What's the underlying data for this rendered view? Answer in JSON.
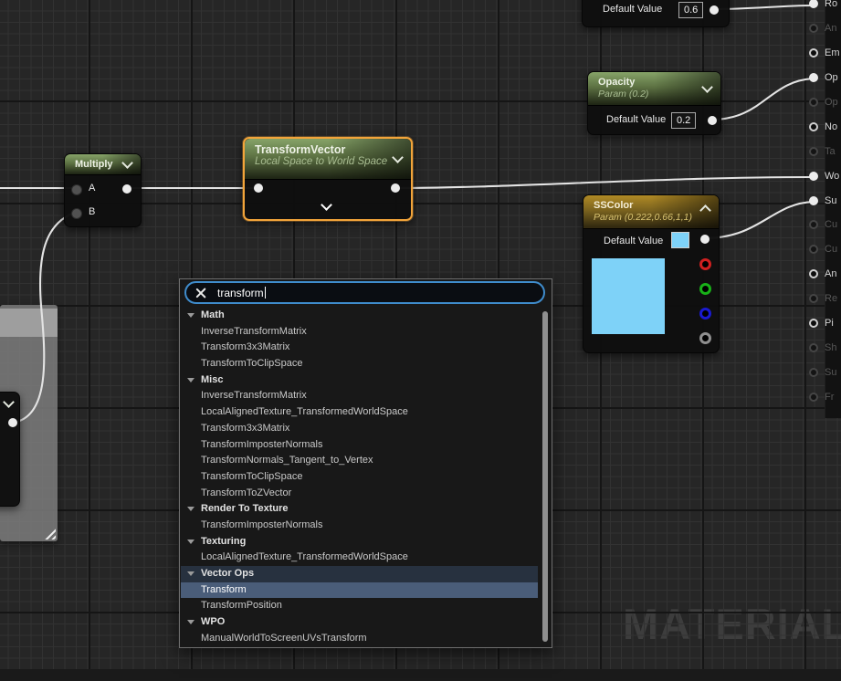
{
  "graph": {
    "param_nodes": {
      "roughness": {
        "label": "Default Value",
        "value": "0.6"
      },
      "opacity": {
        "title": "Opacity",
        "subtitle": "Param (0.2)",
        "label": "Default Value",
        "value": "0.2"
      },
      "sscolor": {
        "title": "SSColor",
        "subtitle": "Param (0.222,0.66,1,1)",
        "label": "Default Value"
      }
    },
    "multiply": {
      "title": "Multiply",
      "input_a": "A",
      "input_b": "B"
    },
    "transform_vector": {
      "title": "TransformVector",
      "subtitle": "Local Space to World Space"
    },
    "output_pins": [
      {
        "label": "Ro",
        "state": "connected"
      },
      {
        "label": "An",
        "state": "dim"
      },
      {
        "label": "Em",
        "state": "open"
      },
      {
        "label": "Op",
        "state": "connected"
      },
      {
        "label": "Op",
        "state": "dim"
      },
      {
        "label": "No",
        "state": "open"
      },
      {
        "label": "Ta",
        "state": "dim"
      },
      {
        "label": "Wo",
        "state": "connected"
      },
      {
        "label": "Su",
        "state": "connected"
      },
      {
        "label": "Cu",
        "state": "dim"
      },
      {
        "label": "Cu",
        "state": "dim"
      },
      {
        "label": "An",
        "state": "open"
      },
      {
        "label": "Re",
        "state": "dim"
      },
      {
        "label": "Pi",
        "state": "open"
      },
      {
        "label": "Sh",
        "state": "dim"
      },
      {
        "label": "Su",
        "state": "dim"
      },
      {
        "label": "Fr",
        "state": "dim"
      }
    ]
  },
  "menu": {
    "search_value": "transform",
    "rows": [
      {
        "type": "category",
        "label": "Math"
      },
      {
        "type": "item",
        "label": "InverseTransformMatrix"
      },
      {
        "type": "item",
        "label": "Transform3x3Matrix"
      },
      {
        "type": "item",
        "label": "TransformToClipSpace"
      },
      {
        "type": "category",
        "label": "Misc"
      },
      {
        "type": "item",
        "label": "InverseTransformMatrix"
      },
      {
        "type": "item",
        "label": "LocalAlignedTexture_TransformedWorldSpace"
      },
      {
        "type": "item",
        "label": "Transform3x3Matrix"
      },
      {
        "type": "item",
        "label": "TransformImposterNormals"
      },
      {
        "type": "item",
        "label": "TransformNormals_Tangent_to_Vertex"
      },
      {
        "type": "item",
        "label": "TransformToClipSpace"
      },
      {
        "type": "item",
        "label": "TransformToZVector"
      },
      {
        "type": "category",
        "label": "Render To Texture"
      },
      {
        "type": "item",
        "label": "TransformImposterNormals"
      },
      {
        "type": "category",
        "label": "Texturing"
      },
      {
        "type": "item",
        "label": "LocalAlignedTexture_TransformedWorldSpace"
      },
      {
        "type": "category",
        "label": "Vector Ops",
        "highlighted": true
      },
      {
        "type": "item",
        "label": "Transform",
        "selected": true
      },
      {
        "type": "item",
        "label": "TransformPosition"
      },
      {
        "type": "category",
        "label": "WPO"
      },
      {
        "type": "item",
        "label": "ManualWorldToScreenUVsTransform"
      }
    ]
  },
  "watermark": "MATERIAL",
  "colors": {
    "selection_orange": "#f2a43a",
    "wire": "#e3e3e3",
    "swatch_blue": "#7ed2f8",
    "pin_r": "#d02020",
    "pin_g": "#18b018",
    "pin_b": "#1a1ad0",
    "pin_a": "#8f8f8f"
  }
}
